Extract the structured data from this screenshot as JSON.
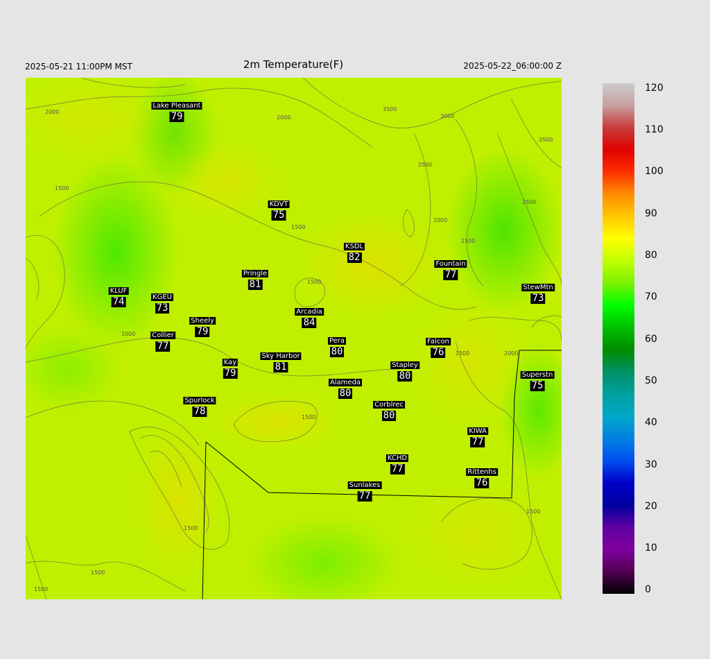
{
  "header": {
    "local_time": "2025-05-21 11:00PM MST",
    "title": "2m Temperature(F)",
    "valid_time": "2025-05-22_06:00:00 Z"
  },
  "contour_labels": [
    "2000",
    "3500",
    "3000",
    "2000",
    "1500",
    "2500",
    "2000",
    "1500",
    "3500",
    "2500",
    "1500",
    "1500",
    "1000",
    "2000",
    "1500",
    "1500",
    "1500",
    "1500",
    "1500",
    "1500"
  ],
  "stations": [
    {
      "name": "Lake Pleasant",
      "value": "79"
    },
    {
      "name": "KDVT",
      "value": "75"
    },
    {
      "name": "KSDL",
      "value": "82"
    },
    {
      "name": "Fountain",
      "value": "77"
    },
    {
      "name": "StewMtn",
      "value": "73"
    },
    {
      "name": "Pringle",
      "value": "81"
    },
    {
      "name": "KLUF",
      "value": "74"
    },
    {
      "name": "KGEU",
      "value": "73"
    },
    {
      "name": "Arcadia",
      "value": "84"
    },
    {
      "name": "Sheely",
      "value": "79"
    },
    {
      "name": "Collier",
      "value": "77"
    },
    {
      "name": "Pera",
      "value": "80"
    },
    {
      "name": "Falcon",
      "value": "76"
    },
    {
      "name": "Kay",
      "value": "79"
    },
    {
      "name": "Sky Harbor",
      "value": "81"
    },
    {
      "name": "Stapley",
      "value": "80"
    },
    {
      "name": "Superstn",
      "value": "75"
    },
    {
      "name": "Alameda",
      "value": "80"
    },
    {
      "name": "Spurlock",
      "value": "78"
    },
    {
      "name": "Corblrec",
      "value": "80"
    },
    {
      "name": "KIWA",
      "value": "77"
    },
    {
      "name": "KCHD",
      "value": "77"
    },
    {
      "name": "Rittenhs",
      "value": "76"
    },
    {
      "name": "Sunlakes",
      "value": "77"
    }
  ],
  "colorbar": {
    "ticks": [
      "120",
      "110",
      "100",
      "90",
      "80",
      "70",
      "60",
      "50",
      "40",
      "30",
      "20",
      "10",
      "0"
    ],
    "colors": [
      "#cccccc",
      "#c8a0a0",
      "#c83c3c",
      "#e00000",
      "#ff3000",
      "#ff8c00",
      "#ffc800",
      "#ffff00",
      "#c0ff00",
      "#7cf000",
      "#00ff00",
      "#00c000",
      "#008c00",
      "#009064",
      "#00a0a0",
      "#00a8c8",
      "#0080e0",
      "#0050f0",
      "#0000c8",
      "#0000a0",
      "#6000a0",
      "#8000a0",
      "#500050",
      "#000000"
    ]
  }
}
